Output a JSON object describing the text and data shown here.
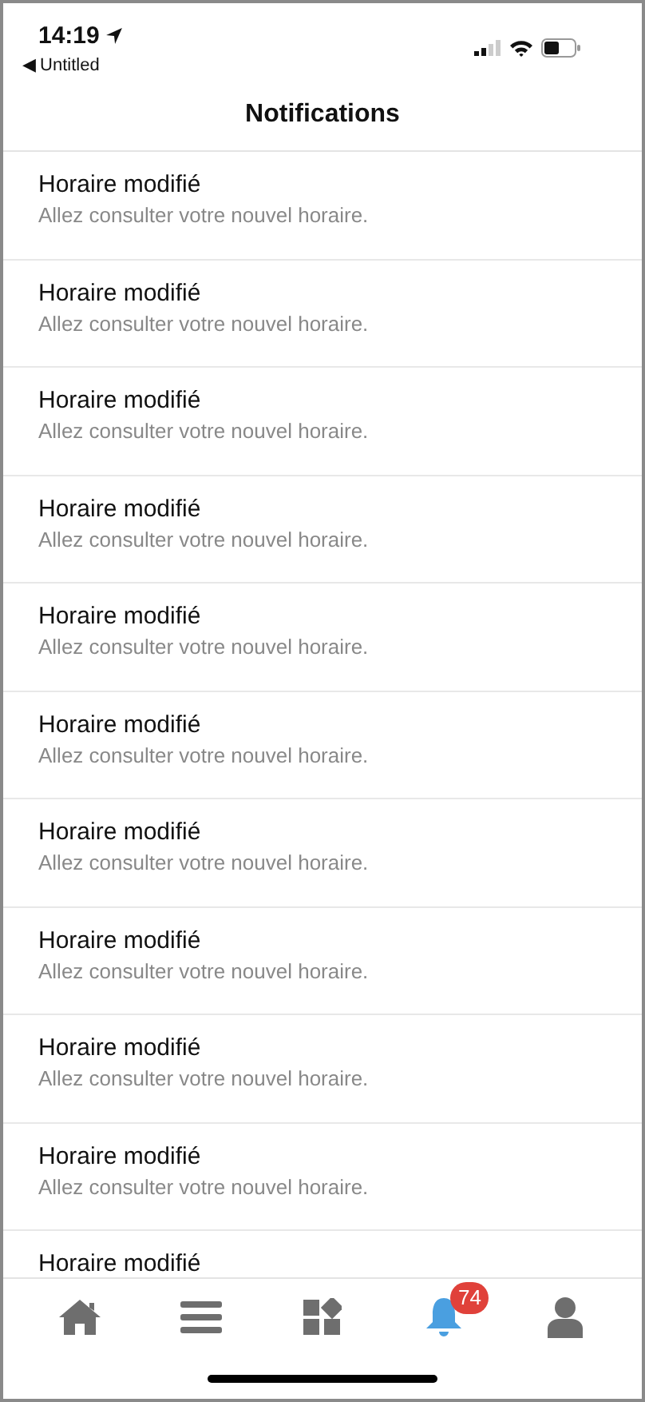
{
  "status_bar": {
    "time": "14:19",
    "back_label": "◀ Untitled"
  },
  "nav": {
    "title": "Notifications"
  },
  "notifications": [
    {
      "title": "Horaire modifié",
      "message": "Allez consulter votre nouvel horaire."
    },
    {
      "title": "Horaire modifié",
      "message": "Allez consulter votre nouvel horaire."
    },
    {
      "title": "Horaire modifié",
      "message": "Allez consulter votre nouvel horaire."
    },
    {
      "title": "Horaire modifié",
      "message": "Allez consulter votre nouvel horaire."
    },
    {
      "title": "Horaire modifié",
      "message": "Allez consulter votre nouvel horaire."
    },
    {
      "title": "Horaire modifié",
      "message": "Allez consulter votre nouvel horaire."
    },
    {
      "title": "Horaire modifié",
      "message": "Allez consulter votre nouvel horaire."
    },
    {
      "title": "Horaire modifié",
      "message": "Allez consulter votre nouvel horaire."
    },
    {
      "title": "Horaire modifié",
      "message": "Allez consulter votre nouvel horaire."
    },
    {
      "title": "Horaire modifié",
      "message": "Allez consulter votre nouvel horaire."
    },
    {
      "title": "Horaire modifié"
    }
  ],
  "tab_bar": [
    {
      "kind": "home",
      "selected": false
    },
    {
      "kind": "menu",
      "selected": false
    },
    {
      "kind": "apps",
      "selected": false
    },
    {
      "kind": "bell",
      "selected": true,
      "badge": "74"
    },
    {
      "kind": "user",
      "selected": false
    }
  ]
}
